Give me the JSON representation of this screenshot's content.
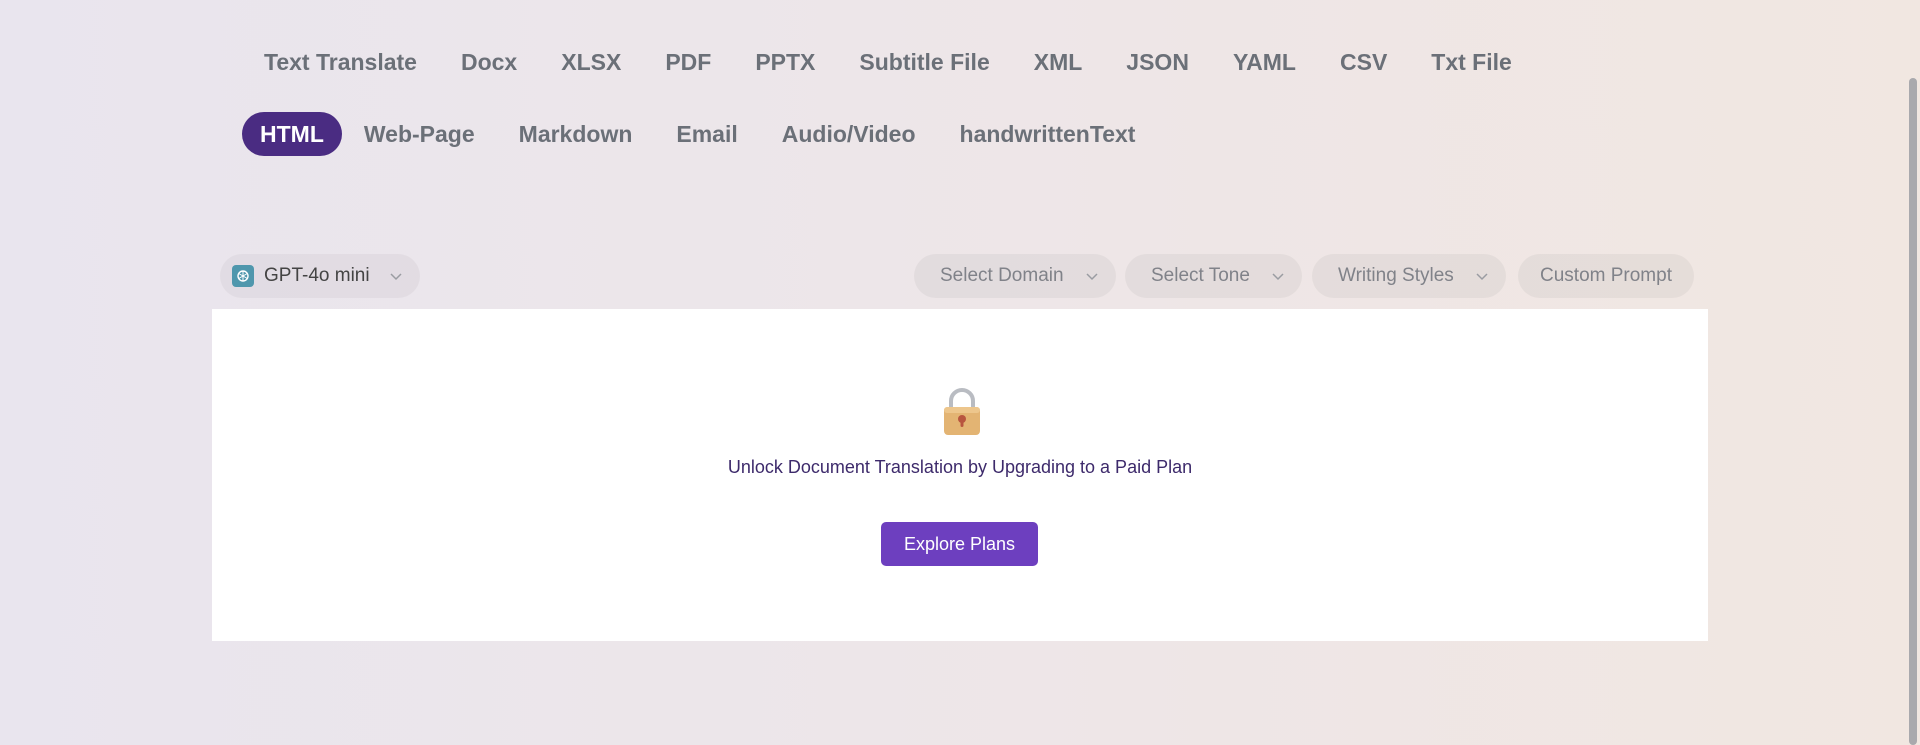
{
  "tabs": [
    {
      "label": "Text Translate",
      "active": false
    },
    {
      "label": "Docx",
      "active": false
    },
    {
      "label": "XLSX",
      "active": false
    },
    {
      "label": "PDF",
      "active": false
    },
    {
      "label": "PPTX",
      "active": false
    },
    {
      "label": "Subtitle File",
      "active": false
    },
    {
      "label": "XML",
      "active": false
    },
    {
      "label": "JSON",
      "active": false
    },
    {
      "label": "YAML",
      "active": false
    },
    {
      "label": "CSV",
      "active": false
    },
    {
      "label": "Txt File",
      "active": false
    },
    {
      "label": "HTML",
      "active": true
    },
    {
      "label": "Web-Page",
      "active": false
    },
    {
      "label": "Markdown",
      "active": false
    },
    {
      "label": "Email",
      "active": false
    },
    {
      "label": "Audio/Video",
      "active": false
    },
    {
      "label": "handwrittenText",
      "active": false
    }
  ],
  "model": {
    "label": "GPT-4o mini",
    "icon": "openai-icon"
  },
  "options": {
    "domain": "Select Domain",
    "tone": "Select Tone",
    "writing_styles": "Writing Styles",
    "custom_prompt": "Custom Prompt"
  },
  "card": {
    "lock_icon": "lock-icon",
    "message": "Unlock Document Translation by Upgrading to a Paid Plan",
    "button_label": "Explore Plans"
  },
  "colors": {
    "active_tab": "#4a2c82",
    "button": "#6d3fbf",
    "message_text": "#3d2a6b"
  }
}
